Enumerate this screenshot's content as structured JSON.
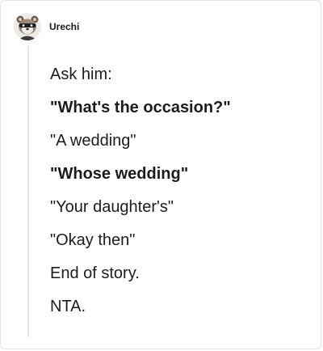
{
  "comment": {
    "username": "Urechi",
    "avatar_icon": "raccoon-avatar-icon",
    "paragraphs": [
      {
        "text": "Ask him:",
        "bold": false
      },
      {
        "text": "\"What's the occasion?\"",
        "bold": true
      },
      {
        "text": "\"A wedding\"",
        "bold": false
      },
      {
        "text": "\"Whose wedding\"",
        "bold": true
      },
      {
        "text": "\"Your daughter's\"",
        "bold": false
      },
      {
        "text": "\"Okay then\"",
        "bold": false
      },
      {
        "text": "End of story.",
        "bold": false
      },
      {
        "text": "NTA.",
        "bold": false
      }
    ]
  }
}
